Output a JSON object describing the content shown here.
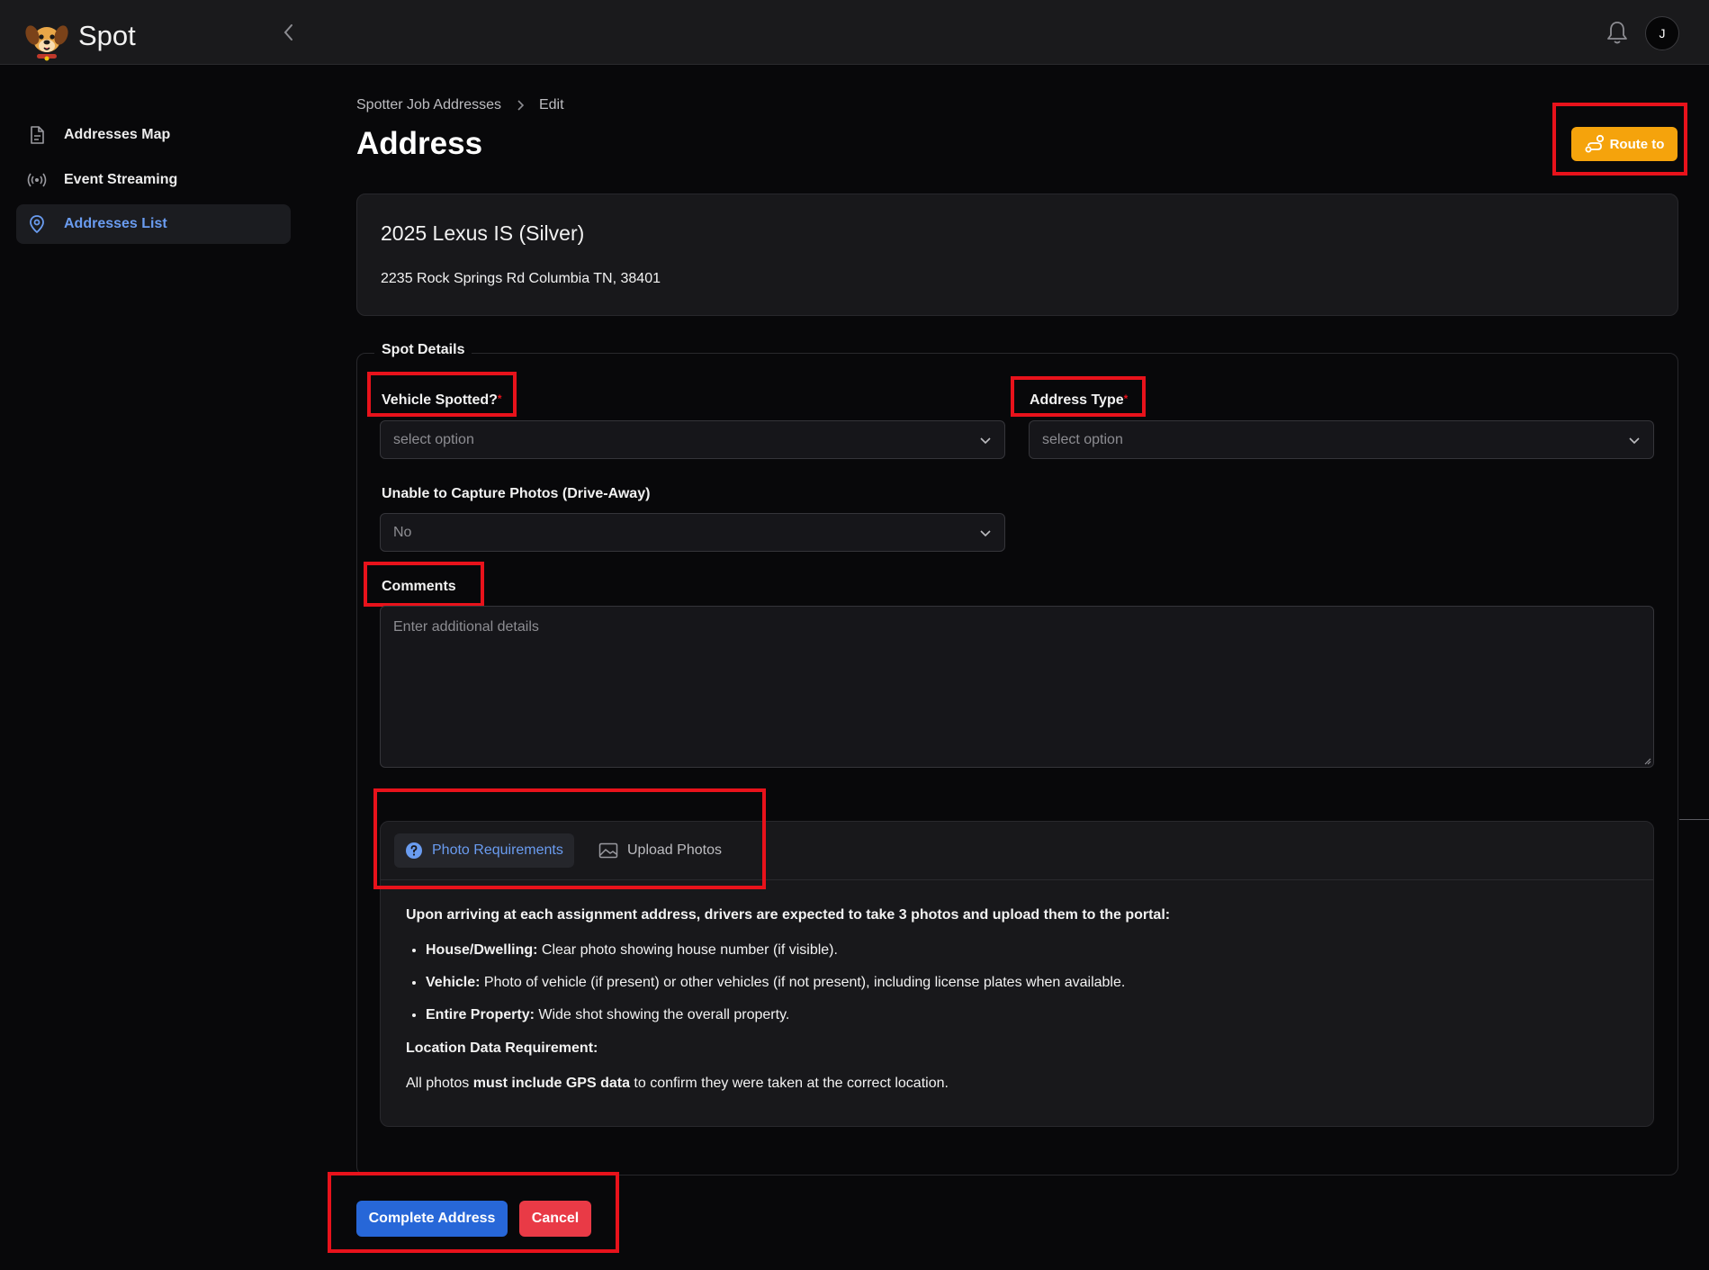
{
  "app": {
    "brand": "Spot",
    "avatar_initial": "J"
  },
  "sidebar": {
    "items": [
      {
        "label": "Addresses Map",
        "icon": "document-icon",
        "active": false
      },
      {
        "label": "Event Streaming",
        "icon": "broadcast-icon",
        "active": false
      },
      {
        "label": "Addresses List",
        "icon": "map-pin-icon",
        "active": true
      }
    ]
  },
  "breadcrumb": {
    "parent": "Spotter Job Addresses",
    "current": "Edit"
  },
  "page": {
    "title": "Address",
    "route_button": "Route to"
  },
  "vehicle": {
    "title": "2025 Lexus IS (Silver)",
    "address": "2235 Rock Springs Rd Columbia TN, 38401"
  },
  "form": {
    "legend": "Spot Details",
    "vehicle_spotted": {
      "label": "Vehicle Spotted?",
      "required": "*",
      "placeholder": "select option"
    },
    "address_type": {
      "label": "Address Type",
      "required": "*",
      "placeholder": "select option"
    },
    "unable_to_capture": {
      "label": "Unable to Capture Photos (Drive-Away)",
      "value": "No"
    },
    "comments": {
      "label": "Comments",
      "placeholder": "Enter additional details"
    }
  },
  "tabs": {
    "photo_requirements": "Photo Requirements",
    "upload_photos": "Upload Photos",
    "content": {
      "intro": "Upon arriving at each assignment address, drivers are expected to take 3 photos and upload them to the portal:",
      "items": [
        {
          "title": "House/Dwelling:",
          "text": " Clear photo showing house number (if visible)."
        },
        {
          "title": "Vehicle:",
          "text": " Photo of vehicle (if present) or other vehicles (if not present), including license plates when available."
        },
        {
          "title": "Entire Property:",
          "text": " Wide shot showing the overall property."
        }
      ],
      "location_heading": "Location Data Requirement:",
      "location_pre": "All photos ",
      "location_bold": "must include GPS data",
      "location_post": " to confirm they were taken at the correct location."
    }
  },
  "actions": {
    "complete": "Complete Address",
    "cancel": "Cancel"
  },
  "colors": {
    "accent": "#2767d8",
    "route": "#f5a30c",
    "danger": "#e93a46",
    "highlight": "#e8121b",
    "active_link": "#6a9cf0"
  }
}
